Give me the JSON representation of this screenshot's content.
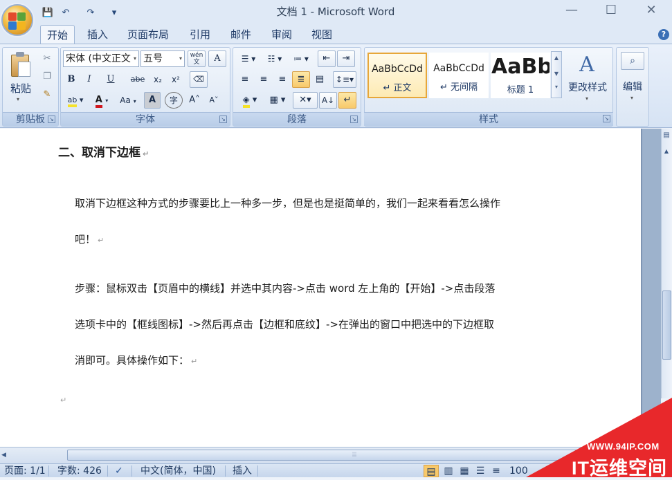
{
  "window": {
    "title": "文档 1 - Microsoft Word",
    "controls": {
      "minimize": "—",
      "maximize": "☐",
      "close": "✕"
    }
  },
  "quick_access": {
    "save": "💾",
    "undo": "↶",
    "redo": "↷",
    "more": "▾"
  },
  "tabs": [
    {
      "label": "开始",
      "active": true
    },
    {
      "label": "插入"
    },
    {
      "label": "页面布局"
    },
    {
      "label": "引用"
    },
    {
      "label": "邮件"
    },
    {
      "label": "审阅"
    },
    {
      "label": "视图"
    }
  ],
  "help_icon": "?",
  "clipboard": {
    "paste_label": "粘贴",
    "group_label": "剪贴板"
  },
  "font": {
    "font_name": "宋体 (中文正文",
    "font_size": "五号",
    "wen": "wén\n文",
    "a_box": "A",
    "bold": "B",
    "italic": "I",
    "underline": "U",
    "strike": "abe",
    "subscript": "x₂",
    "superscript": "x²",
    "highlight": "ab",
    "font_color": "A",
    "case": "Aa",
    "char_shade": "A",
    "enclose": "字",
    "grow": "A˄",
    "shrink": "A˅",
    "group_label": "字体"
  },
  "paragraph": {
    "group_label": "段落"
  },
  "styles": {
    "items": [
      {
        "sample": "AaBbCcDd",
        "name": "↵ 正文",
        "selected": true
      },
      {
        "sample": "AaBbCcDd",
        "name": "↵ 无间隔"
      },
      {
        "sample": "AaBb",
        "name": "标题 1"
      }
    ],
    "change_label": "更改样式",
    "group_label": "样式"
  },
  "editing": {
    "label": "编辑"
  },
  "document": {
    "heading": "二、取消下边框",
    "paragraphs": [
      "取消下边框这种方式的步骤要比上一种多一步，但是也是挺简单的，我们一起来看看怎么操作",
      "吧！",
      "步骤：鼠标双击【页眉中的横线】并选中其内容->点击 word 左上角的【开始】->点击段落",
      "选项卡中的【框线图标】->然后再点击【边框和底纹】->在弹出的窗口中把选中的下边框取",
      "消即可。具体操作如下："
    ],
    "para_mark": "↵"
  },
  "status": {
    "page": "页面: 1/1",
    "words": "字数: 426",
    "language": "中文(简体，中国)",
    "mode": "插入",
    "zoom": "100"
  },
  "watermark": {
    "url": "WWW.94IP.COM",
    "brand": "IT运维空间"
  }
}
